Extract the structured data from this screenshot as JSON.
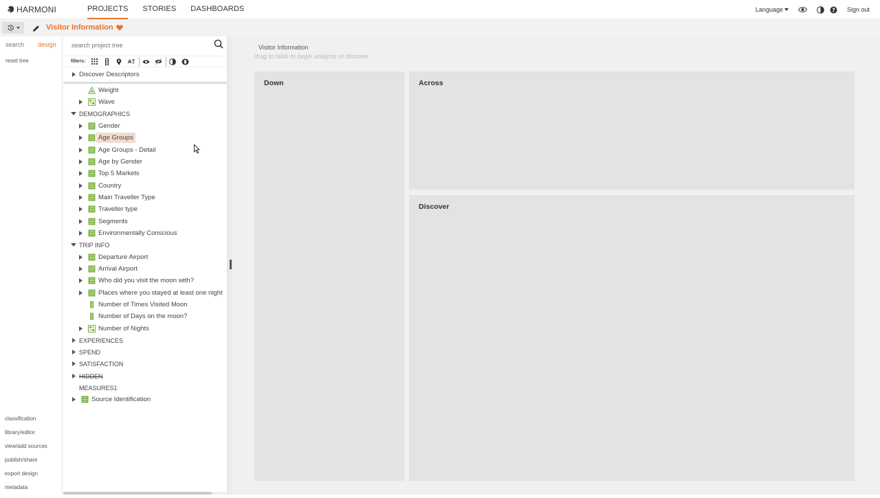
{
  "app": {
    "logo_text": "HARMONI",
    "nav": [
      "PROJECTS",
      "STORIES",
      "DASHBOARDS"
    ],
    "language_label": "Language",
    "signout_label": "Sign out"
  },
  "project": {
    "title": "Visitor Information"
  },
  "modes": {
    "search": "search",
    "design": "design",
    "reset": "reset tree"
  },
  "bottom_links": [
    "classification",
    "library/editor",
    "view/add sources",
    "publish/share",
    "export design",
    "metadata"
  ],
  "tree": {
    "search_placeholder": "search project tree",
    "filters_label": "filters:",
    "rows": [
      {
        "label": "Discover Descriptors",
        "level": 0,
        "arrow": "right",
        "icon": "none"
      },
      {
        "label": "Weight",
        "level": 1,
        "arrow": "none",
        "icon": "weight"
      },
      {
        "label": "Wave",
        "level": 1,
        "arrow": "right",
        "icon": "grid-green"
      },
      {
        "label": "DEMOGRAPHICS",
        "level": 0,
        "arrow": "down",
        "icon": "none"
      },
      {
        "label": "Gender",
        "level": 2,
        "arrow": "right",
        "icon": "green-bar"
      },
      {
        "label": "Age Groups",
        "level": 2,
        "arrow": "right",
        "icon": "green-bar",
        "highlight": true
      },
      {
        "label": "Age Groups - Detail",
        "level": 2,
        "arrow": "right",
        "icon": "green-bar"
      },
      {
        "label": "Age by Gender",
        "level": 2,
        "arrow": "right",
        "icon": "green-bar"
      },
      {
        "label": "Top 5 Markets",
        "level": 2,
        "arrow": "right",
        "icon": "green-bar"
      },
      {
        "label": "Country",
        "level": 2,
        "arrow": "right",
        "icon": "green-bar"
      },
      {
        "label": "Main Traveller Type",
        "level": 2,
        "arrow": "right",
        "icon": "green-bar"
      },
      {
        "label": "Traveller type",
        "level": 2,
        "arrow": "right",
        "icon": "green-bar"
      },
      {
        "label": "Segments",
        "level": 2,
        "arrow": "right",
        "icon": "green-bar"
      },
      {
        "label": "Environmentally Conscious",
        "level": 2,
        "arrow": "right",
        "icon": "green-bar"
      },
      {
        "label": "TRIP INFO",
        "level": 0,
        "arrow": "down",
        "icon": "none"
      },
      {
        "label": "Departure Airport",
        "level": 2,
        "arrow": "right",
        "icon": "green-bar"
      },
      {
        "label": "Arrival Airport",
        "level": 2,
        "arrow": "right",
        "icon": "green-bar"
      },
      {
        "label": "Who did you visit the moon with?",
        "level": 2,
        "arrow": "right",
        "icon": "green-bar"
      },
      {
        "label": "Places where you stayed at least one night",
        "level": 2,
        "arrow": "right",
        "icon": "green-bar"
      },
      {
        "label": "Number of Times Visited Moon",
        "level": 2,
        "arrow": "none",
        "icon": "numeric"
      },
      {
        "label": "Number of Days on the moon?",
        "level": 2,
        "arrow": "none",
        "icon": "numeric"
      },
      {
        "label": "Number of Nights",
        "level": 2,
        "arrow": "right",
        "icon": "grid-green"
      },
      {
        "label": "EXPERIENCES",
        "level": 0,
        "arrow": "right",
        "icon": "none"
      },
      {
        "label": "SPEND",
        "level": 0,
        "arrow": "right",
        "icon": "none"
      },
      {
        "label": "SATISFACTION",
        "level": 0,
        "arrow": "right",
        "icon": "none"
      },
      {
        "label": "HIDDEN",
        "level": 0,
        "arrow": "right",
        "icon": "none",
        "strike": true
      },
      {
        "label": "MEASURES1",
        "level": 0,
        "arrow": "none",
        "icon": "none"
      },
      {
        "label": "Source Identification",
        "level": 1,
        "arrow": "right",
        "icon": "green-bar"
      }
    ]
  },
  "main": {
    "title": "Visitor Information",
    "hint": "drag to table to begin analysis or discover",
    "zones": {
      "down": "Down",
      "across": "Across",
      "discover": "Discover"
    }
  },
  "colors": {
    "accent": "#e8722c",
    "green": "#7cb342"
  }
}
